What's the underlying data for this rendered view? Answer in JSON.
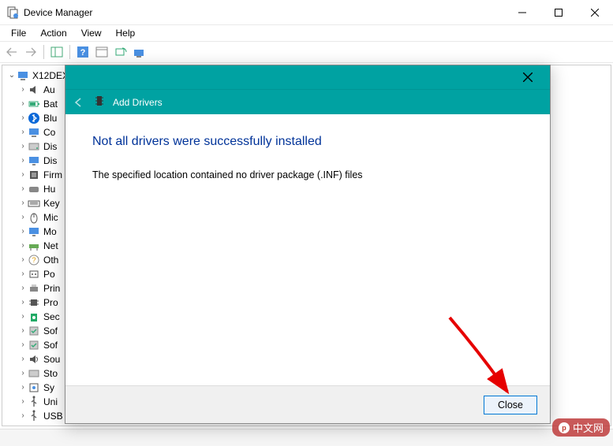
{
  "window": {
    "title": "Device Manager",
    "controls": {
      "min": "—",
      "max": "▢",
      "close": "✕"
    }
  },
  "menu": {
    "file": "File",
    "action": "Action",
    "view": "View",
    "help": "Help"
  },
  "tree": {
    "root": "X12DEX",
    "items": [
      {
        "label": "Au",
        "icon": "audio"
      },
      {
        "label": "Bat",
        "icon": "battery"
      },
      {
        "label": "Blu",
        "icon": "bluetooth"
      },
      {
        "label": "Co",
        "icon": "computer"
      },
      {
        "label": "Dis",
        "icon": "disk"
      },
      {
        "label": "Dis",
        "icon": "display"
      },
      {
        "label": "Firm",
        "icon": "firmware"
      },
      {
        "label": "Hu",
        "icon": "hid"
      },
      {
        "label": "Key",
        "icon": "keyboard"
      },
      {
        "label": "Mic",
        "icon": "mouse"
      },
      {
        "label": "Mo",
        "icon": "monitor"
      },
      {
        "label": "Net",
        "icon": "network"
      },
      {
        "label": "Oth",
        "icon": "other"
      },
      {
        "label": "Po",
        "icon": "ports"
      },
      {
        "label": "Prin",
        "icon": "printer"
      },
      {
        "label": "Pro",
        "icon": "processor"
      },
      {
        "label": "Sec",
        "icon": "security"
      },
      {
        "label": "Sof",
        "icon": "software"
      },
      {
        "label": "Sof",
        "icon": "software"
      },
      {
        "label": "Sou",
        "icon": "sound"
      },
      {
        "label": "Sto",
        "icon": "storage"
      },
      {
        "label": "Sy",
        "icon": "system"
      },
      {
        "label": "Uni",
        "icon": "usb"
      },
      {
        "label": "USB",
        "icon": "usb"
      }
    ]
  },
  "dialog": {
    "wizard_title": "Add Drivers",
    "heading": "Not all drivers were successfully installed",
    "body": "The specified location contained no driver package (.INF) files",
    "close_btn": "Close"
  },
  "watermark": "中文网"
}
